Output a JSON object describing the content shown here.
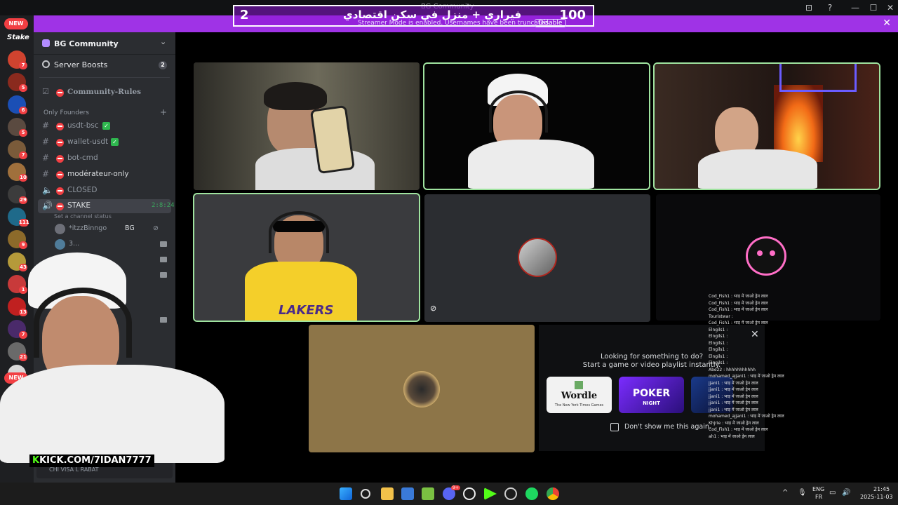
{
  "window": {
    "title": "BG Community",
    "controls": [
      "⊡",
      "?",
      "—",
      "☐",
      "✕"
    ]
  },
  "overlay": {
    "left_number": "2",
    "right_number": "100",
    "arabic_text": "فيراري + منزل في سكن اقتصادي",
    "streamer_note": "Streamer Mode is enabled. Usernames have been truncated.",
    "disable_label": "Disable"
  },
  "rail": {
    "new_label": "NEW",
    "stake_label": "Stake",
    "badges": [
      "7",
      "5",
      "6",
      "5",
      "7",
      "10",
      "29",
      "111",
      "9",
      "43",
      "1",
      "13",
      "7",
      "21",
      "1"
    ],
    "new_label_2": "NEW"
  },
  "sidebar": {
    "server_name": "BG Community",
    "boosts_label": "Server Boosts",
    "boosts_count": "2",
    "rules_channel": "Community-Rules",
    "category": "Only Founders",
    "channels": [
      {
        "name": "usdt-bsc"
      },
      {
        "name": "wallet-usdt"
      },
      {
        "name": "bot-cmd"
      },
      {
        "name": "modérateur-only"
      },
      {
        "name": "CLOSED"
      }
    ],
    "active_voice": "STAKE",
    "active_timer": "2:8:24",
    "channel_status": "Set a channel status",
    "voice_users": [
      {
        "name": "*itzzBinngo",
        "tag": "BG"
      },
      {
        "name": "3..."
      },
      {
        "name": ""
      },
      {
        "name": "BG"
      },
      {
        "name": ""
      }
    ],
    "user_status": "CHI VISA L RABAT"
  },
  "activity": {
    "line1": "Looking for something to do?",
    "line2": "Start a game or video playlist instantly.",
    "cards": [
      "Wordle",
      "POKER NIGHT",
      ""
    ],
    "wordle_sub": "The New York Times Games",
    "poker_sub": "NIGHT",
    "dont_show": "Don't show me this again."
  },
  "chat": {
    "lines": [
      "Cod_Fish1 : भाड़ में जाओ ड्रेन लाल",
      "Cod_Fish1 : भाड़ में जाओ ड्रेन लाल",
      "Cod_Fish1 : भाड़ में जाओ ड्रेन लाल",
      "Touristwar :",
      "Cod_Fish1 : भाड़ में जाओ ड्रेन लाल",
      "Elngils1 :",
      "Elngils1 :",
      "Elngils1 :",
      "Elngils1 :",
      "Elngils1 :",
      "Elngils1 :",
      "Abe22 : hhhhhhhhhhh",
      "mohamed_ajjani1 : भाड़ में जाओ ड्रेन लाल",
      "jjani1 : भाड़ में जाओ ड्रेन लाल",
      "jjani1 : भाड़ में जाओ ड्रेन लाल",
      "jjani1 : भाड़ में जाओ ड्रेन लाल",
      "jjani1 : भाड़ में जाओ ड्रेन लाल",
      "jjani1 : भाड़ में जाओ ड्रेन लाल",
      "mohamed_ajjani1 : भाड़ में जाओ ड्रेन लाल",
      "Khjrie : भाड़ में जाओ ड्रेन लाल",
      "Cod_Fish1 : भाड़ में जाओ ड्रेन लाल",
      "ah1 : भाड़ में जाओ ड्रेन लाल"
    ]
  },
  "stream": {
    "kick_prefix": "K",
    "kick_url": "KICK.COM/7IDAN7777"
  },
  "taskbar": {
    "lang_top": "ENG",
    "lang_bottom": "FR",
    "time": "21:45",
    "date": "2025-11-03",
    "discord_badge": "9+"
  },
  "colors": {
    "banner": "#9f33e6",
    "speaking": "#9fe39f",
    "dnd_red": "#f23f43",
    "online": "#3ba55d",
    "kick_green": "#53fc18"
  }
}
